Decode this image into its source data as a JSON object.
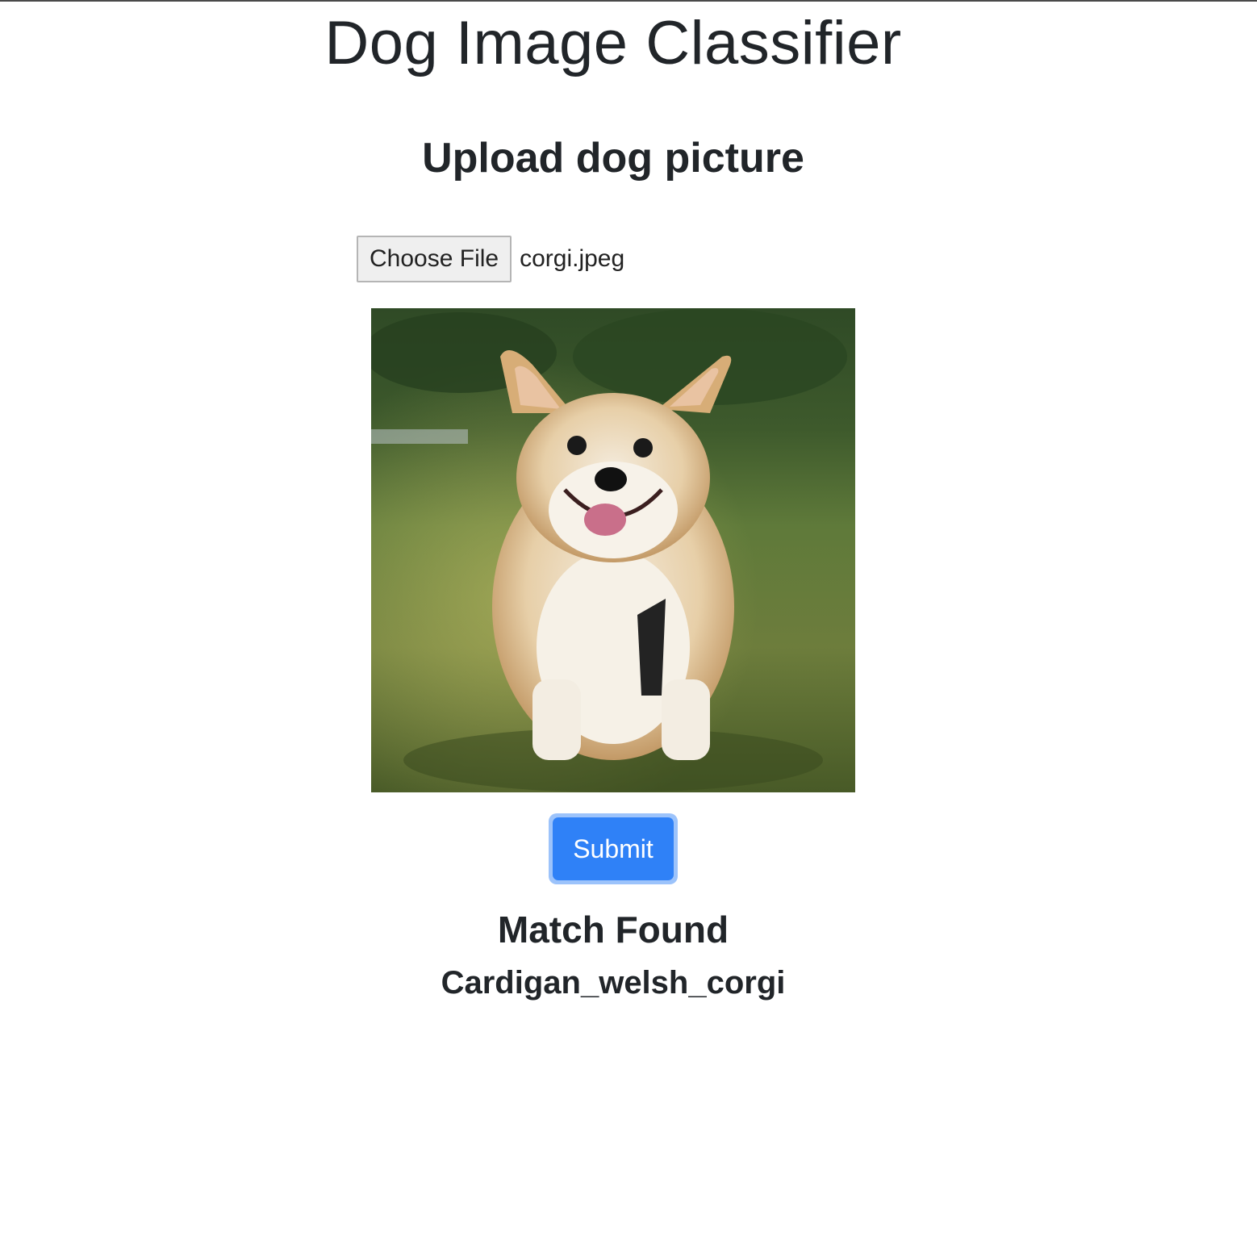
{
  "header": {
    "title": "Dog Image Classifier"
  },
  "upload": {
    "heading": "Upload dog picture",
    "choose_button_label": "Choose File",
    "selected_file": "corgi.jpeg",
    "preview_alt": "corgi dog photo"
  },
  "actions": {
    "submit_label": "Submit"
  },
  "result": {
    "title": "Match Found",
    "label": "Cardigan_welsh_corgi"
  },
  "colors": {
    "text": "#212529",
    "submit_bg": "#2f81f7",
    "submit_focus_ring": "#9cc3fb"
  }
}
